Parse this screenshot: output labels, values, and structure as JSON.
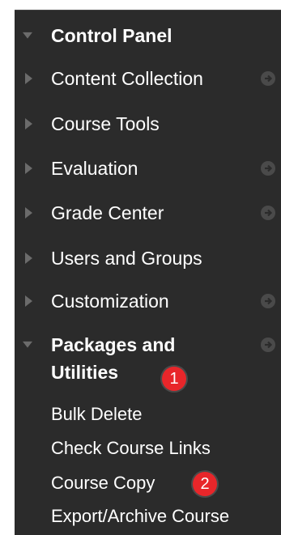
{
  "menu": {
    "title": "Control Panel",
    "items": [
      {
        "label": "Content Collection"
      },
      {
        "label": "Course Tools"
      },
      {
        "label": "Evaluation"
      },
      {
        "label": "Grade Center"
      },
      {
        "label": "Users and Groups"
      },
      {
        "label": "Customization"
      }
    ],
    "expanded": {
      "label_line1": "Packages and",
      "label_line2": "Utilities",
      "subitems": [
        {
          "label": "Bulk Delete"
        },
        {
          "label": "Check Course Links"
        },
        {
          "label": "Course Copy"
        },
        {
          "label": "Export/Archive Course"
        }
      ]
    }
  },
  "annotations": {
    "badge1": "1",
    "badge2": "2"
  },
  "colors": {
    "panel_bg": "#2b2b2b",
    "badge": "#e8262a"
  }
}
